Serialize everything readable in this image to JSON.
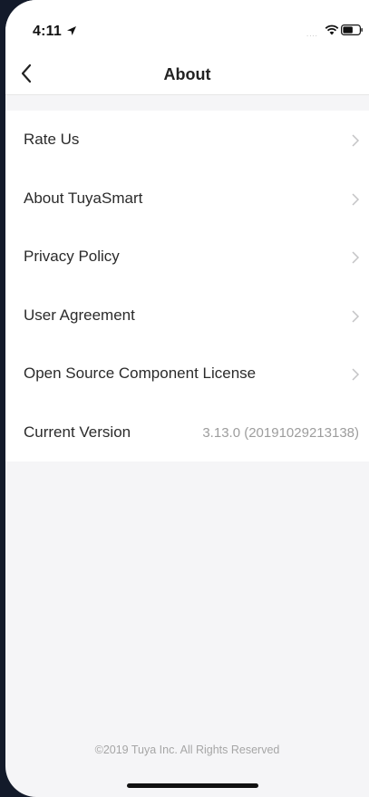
{
  "status_bar": {
    "time": "4:11",
    "signal": "....",
    "icons": [
      "location-arrow-icon",
      "wifi-icon",
      "battery-icon"
    ]
  },
  "nav": {
    "title": "About",
    "back_icon": "chevron-left-icon"
  },
  "menu": {
    "items": [
      {
        "label": "Rate Us"
      },
      {
        "label": "About TuyaSmart"
      },
      {
        "label": "Privacy Policy"
      },
      {
        "label": "User Agreement"
      },
      {
        "label": "Open Source Component License"
      }
    ],
    "version": {
      "label": "Current Version",
      "value": "3.13.0 (20191029213138)"
    }
  },
  "footer": {
    "copyright": "©2019 Tuya Inc. All Rights Reserved"
  },
  "colors": {
    "background": "#f5f5f7",
    "surface": "#ffffff",
    "text_primary": "#2b2b2b",
    "text_secondary": "#9d9d9d",
    "outer_bezel": "#131a2a"
  }
}
